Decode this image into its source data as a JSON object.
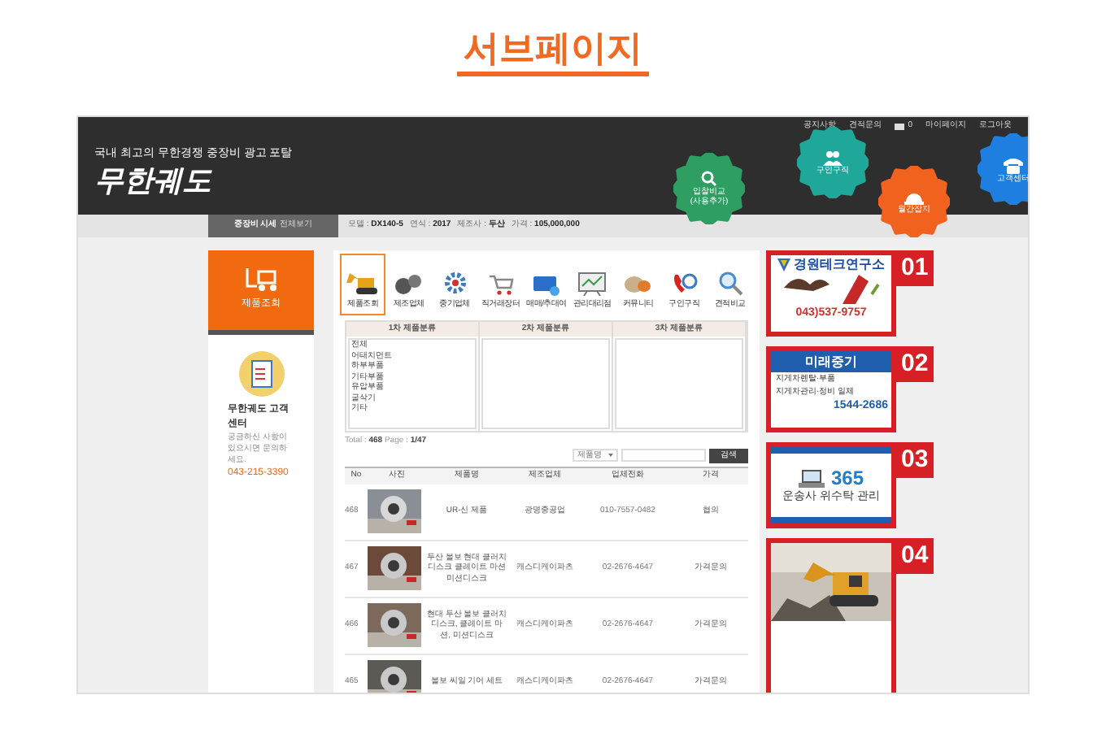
{
  "page_title": "서브페이지",
  "header": {
    "top_links": [
      {
        "kind": "link",
        "label": "공지사항"
      },
      {
        "kind": "link",
        "label": "견적문의"
      },
      {
        "kind": "mail",
        "label": "0"
      },
      {
        "kind": "link",
        "label": "마이페이지"
      },
      {
        "kind": "link",
        "label": "로그아웃"
      }
    ],
    "slogan": "국내 최고의 무한경쟁 중장비 광고 포탈",
    "logo": "무한궤도",
    "gears": [
      {
        "label": "입찰비교",
        "sub": "(사용추가)",
        "color": "#2e9e63",
        "kind": "search"
      },
      {
        "label": "구인구직",
        "color": "#1fa89a",
        "kind": "people"
      },
      {
        "label": "월간잡지",
        "color": "#f0621e",
        "kind": "helmet"
      },
      {
        "label": "고객센터",
        "color": "#1e7fe0",
        "kind": "phone"
      }
    ]
  },
  "price_bar": {
    "button": "중장비 시세",
    "button_link": "전체보기",
    "fields": [
      {
        "label": "모델 :",
        "value": "DX140-5"
      },
      {
        "label": "연식 :",
        "value": "2017"
      },
      {
        "label": "제조사 :",
        "value": "두산"
      },
      {
        "label": "가격 :",
        "value": "105,000,000"
      }
    ]
  },
  "sidebar": {
    "menu_title": "제품조회",
    "support_title": "무한궤도 고객센터",
    "support_text": "궁금하신 사항이 있으시면 문의하세요.",
    "phone": "043-215-3390"
  },
  "tabs": [
    {
      "label": "제품조회",
      "selected": true,
      "kind": "excavator"
    },
    {
      "label": "제조업체",
      "selected": false,
      "kind": "parts"
    },
    {
      "label": "중기업체",
      "selected": false,
      "kind": "gear"
    },
    {
      "label": "직거래장터",
      "selected": false,
      "kind": "cart"
    },
    {
      "label": "매매/추대여",
      "selected": false,
      "kind": "card"
    },
    {
      "label": "관리대리점",
      "selected": false,
      "kind": "board"
    },
    {
      "label": "커뮤니티",
      "selected": false,
      "kind": "chat"
    },
    {
      "label": "구인구직",
      "selected": false,
      "kind": "phone"
    },
    {
      "label": "견적비교",
      "selected": false,
      "kind": "search"
    }
  ],
  "categories": [
    {
      "title": "1차 제품분류",
      "items": [
        "전체",
        "어태치먼트",
        "하부부품",
        "기타부품",
        "유압부품",
        "굴삭기",
        "기타"
      ]
    },
    {
      "title": "2차 제품분류"
    },
    {
      "title": "3차 제품분류"
    }
  ],
  "total": {
    "label": "Total :",
    "count": "468",
    "page_label": "Page :",
    "page": "1/47"
  },
  "search": {
    "select": "제품명",
    "button": "검색"
  },
  "table": {
    "columns": [
      "No",
      "사진",
      "제품명",
      "제조업체",
      "업체전화",
      "가격"
    ],
    "rows": [
      {
        "no": "468",
        "name": "UR-신 제품",
        "maker": "광명중공업",
        "phone": "010-7557-0482",
        "price": "협의"
      },
      {
        "no": "467",
        "name": "두산 볼보 현대 클러치 디스크 클레이트 마션 미션디스크",
        "maker": "캐스디케이파츠",
        "phone": "02-2676-4647",
        "price": "가격문의"
      },
      {
        "no": "466",
        "name": "현대 두산 볼보 클러치 디스크, 클레이트 마션, 미션디스크",
        "maker": "캐스디케이파츠",
        "phone": "02-2676-4647",
        "price": "가격문의"
      },
      {
        "no": "465",
        "name": "볼보 씨일 기어 세트",
        "maker": "캐스디케이파츠",
        "phone": "02-2676-4647",
        "price": "가격문의"
      }
    ]
  },
  "ads": [
    {
      "number": "01",
      "kind": "lab",
      "title": "경원테크연구소",
      "phone": "043)537-9757"
    },
    {
      "number": "02",
      "kind": "rental",
      "title": "미래중기",
      "lines": [
        "지게차렌탈·부품",
        "지게차관리·정비 일체"
      ],
      "phone": "1544-2686"
    },
    {
      "number": "03",
      "kind": "service",
      "title": "365",
      "text": "운송사 위수탁 관리"
    },
    {
      "number": "04",
      "kind": "picture"
    }
  ]
}
